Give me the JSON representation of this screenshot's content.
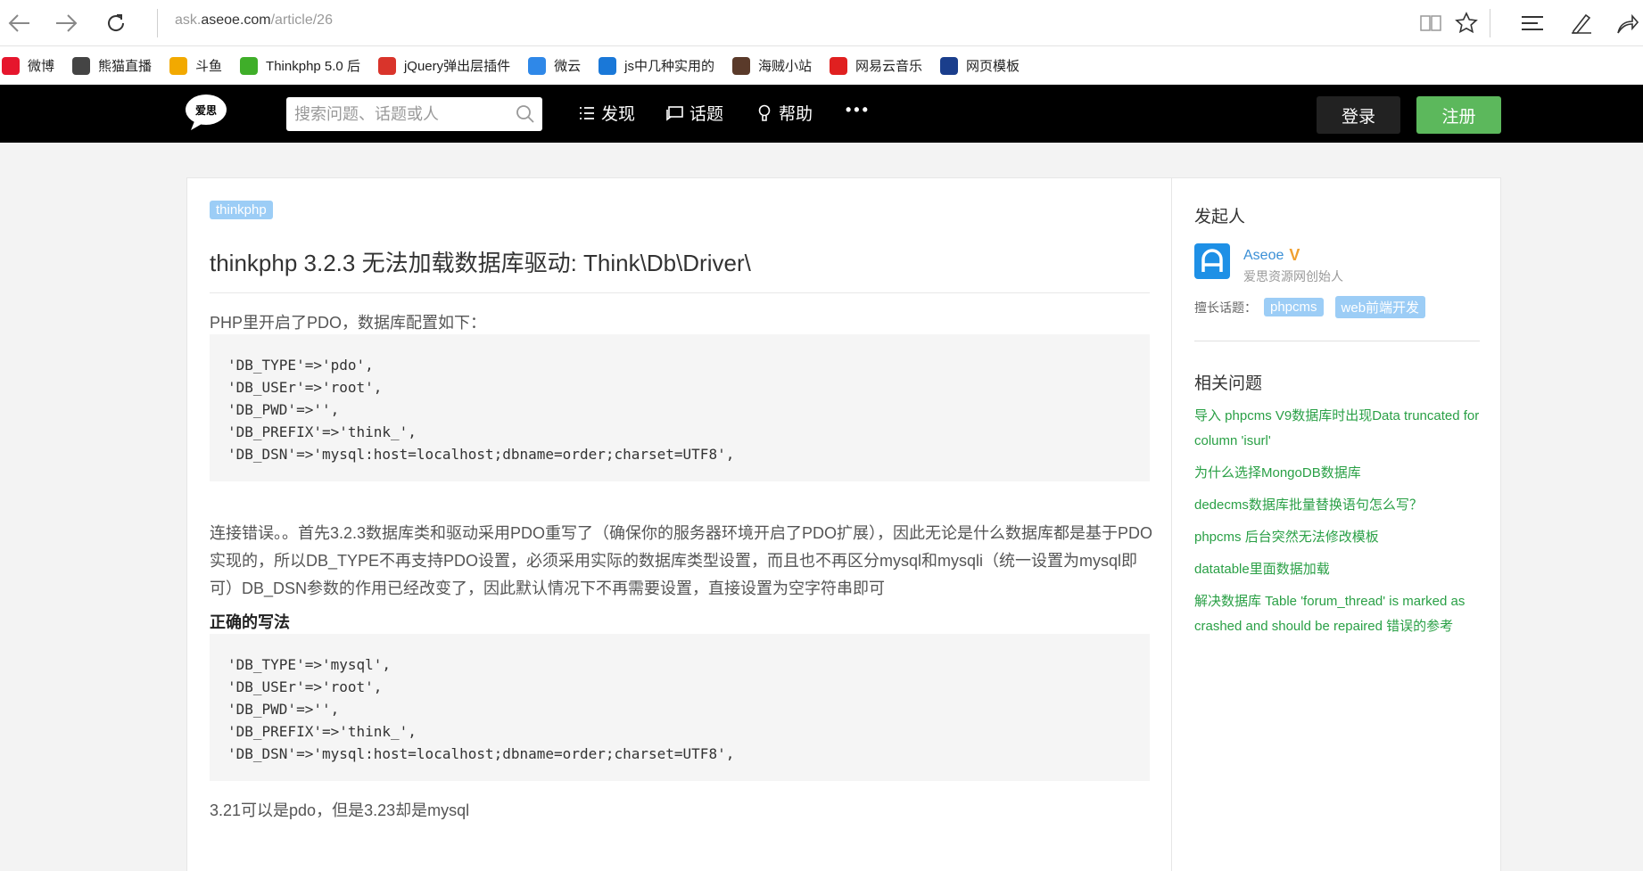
{
  "browser": {
    "url_prefix": "ask.",
    "url_domain": "aseoe.com",
    "url_path": "/article/26"
  },
  "favorites": [
    {
      "label": "微博",
      "icon": "weibo-icon",
      "color": "#e6162d"
    },
    {
      "label": "熊猫直播",
      "icon": "panda-icon",
      "color": "#444444"
    },
    {
      "label": "斗鱼",
      "icon": "douyu-icon",
      "color": "#f2a900"
    },
    {
      "label": "Thinkphp 5.0 后",
      "icon": "thinkphp-icon",
      "color": "#3fae29"
    },
    {
      "label": "jQuery弹出层插件",
      "icon": "jquery-icon",
      "color": "#d9342b"
    },
    {
      "label": "微云",
      "icon": "weiyun-icon",
      "color": "#2f88e8"
    },
    {
      "label": "js中几种实用的",
      "icon": "js-icon",
      "color": "#1a78d8"
    },
    {
      "label": "海贼小站",
      "icon": "pirate-icon",
      "color": "#5a3a2a"
    },
    {
      "label": "网易云音乐",
      "icon": "netease-music-icon",
      "color": "#e02020"
    },
    {
      "label": "网页模板",
      "icon": "template-icon",
      "color": "#1a3e8c"
    }
  ],
  "header": {
    "logo_text": "爱思",
    "search_placeholder": "搜索问题、话题或人",
    "menu": [
      {
        "label": "发现",
        "icon": "list-icon"
      },
      {
        "label": "话题",
        "icon": "chat-icon"
      },
      {
        "label": "帮助",
        "icon": "bulb-icon"
      }
    ],
    "more": "•••",
    "login": "登录",
    "register": "注册"
  },
  "article": {
    "tag": "thinkphp",
    "title": "thinkphp 3.2.3 无法加载数据库驱动: Think\\Db\\Driver\\",
    "intro": "PHP里开启了PDO，数据库配置如下：",
    "code1": [
      "'DB_TYPE'=>'pdo',",
      "'DB_USEr'=>'root',",
      "'DB_PWD'=>'',",
      "'DB_PREFIX'=>'think_',",
      "'DB_DSN'=>'mysql:host=localhost;dbname=order;charset=UTF8',"
    ],
    "answer": "连接错误。。首先3.2.3数据库类和驱动采用PDO重写了（确保你的服务器环境开启了PDO扩展），因此无论是什么数据库都是基于PDO实现的，所以DB_TYPE不再支持PDO设置，必须采用实际的数据库类型设置，而且也不再区分mysql和mysqli（统一设置为mysql即可）DB_DSN参数的作用已经改变了，因此默认情况下不再需要设置，直接设置为空字符串即可",
    "correct_heading": "正确的写法",
    "code2": [
      "'DB_TYPE'=>'mysql',",
      "'DB_USEr'=>'root',",
      "'DB_PWD'=>'',",
      "'DB_PREFIX'=>'think_',",
      "'DB_DSN'=>'mysql:host=localhost;dbname=order;charset=UTF8',"
    ],
    "footer": "3.21可以是pdo，但是3.23却是mysql"
  },
  "sidebar": {
    "author_heading": "发起人",
    "author_name": "Aseoe",
    "author_badge": "V",
    "author_title": "爱思资源网创始人",
    "good_at_label": "擅长话题：",
    "good_at_tags": [
      "phpcms",
      "web前端开发"
    ],
    "related_heading": "相关问题",
    "related": [
      "导入 phpcms V9数据库时出现Data truncated for column 'isurl'",
      "为什么选择MongoDB数据库",
      "dedecms数据库批量替换语句怎么写？",
      "phpcms 后台突然无法修改模板",
      "datatable里面数据加载",
      "解决数据库 Table 'forum_thread' is marked as crashed and should be repaired 错误的参考"
    ]
  }
}
